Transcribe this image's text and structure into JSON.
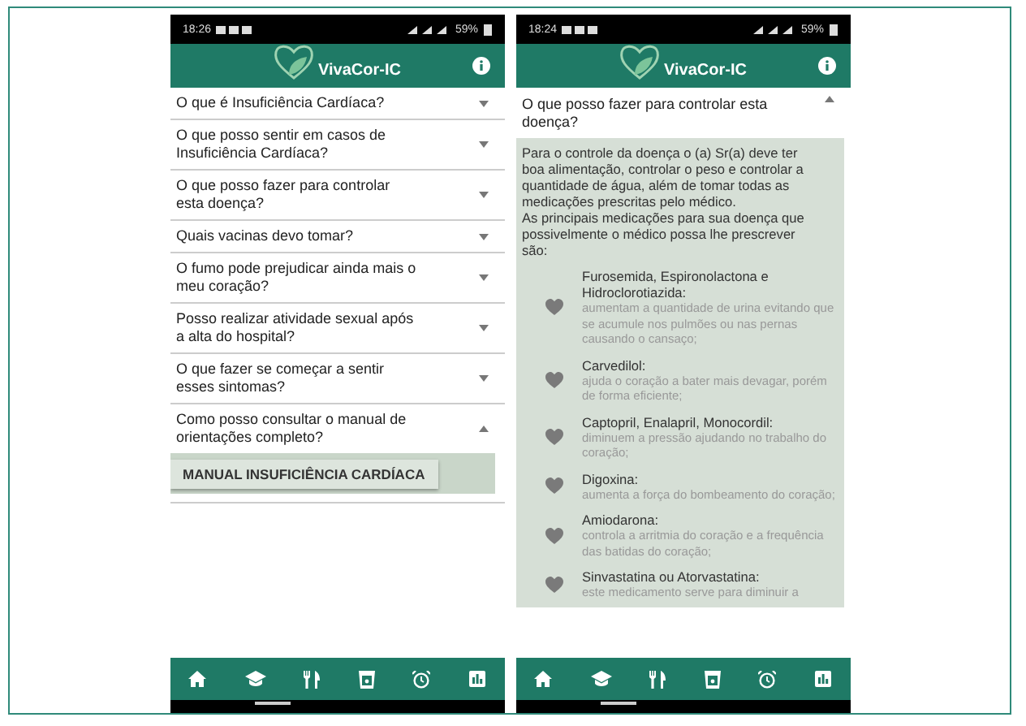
{
  "left_screen": {
    "status_bar": {
      "time": "18:26",
      "battery": "59%"
    },
    "app_title": "VivaCor-IC",
    "faq": [
      {
        "question": "O que é Insuficiência Cardíaca?",
        "expanded": false
      },
      {
        "question": "O que posso sentir em casos de Insuficiência Cardíaca?",
        "expanded": false
      },
      {
        "question": "O que posso fazer para controlar esta doença?",
        "expanded": false
      },
      {
        "question": "Quais vacinas devo tomar?",
        "expanded": false
      },
      {
        "question": "O fumo pode prejudicar ainda mais o meu coração?",
        "expanded": false
      },
      {
        "question": "Posso realizar atividade sexual após a alta do hospital?",
        "expanded": false
      },
      {
        "question": "O que fazer se começar a sentir esses sintomas?",
        "expanded": false
      },
      {
        "question": "Como posso consultar o manual de orientações completo?",
        "expanded": true,
        "button": "MANUAL INSUFICIÊNCIA CARDÍACA"
      }
    ],
    "nav": [
      {
        "kind": "home"
      },
      {
        "kind": "learn"
      },
      {
        "kind": "food"
      },
      {
        "kind": "cup"
      },
      {
        "kind": "alarm"
      },
      {
        "kind": "chart"
      }
    ]
  },
  "right_screen": {
    "status_bar": {
      "time": "18:24",
      "battery": "59%"
    },
    "app_title": "VivaCor-IC",
    "question": "O que posso fazer para controlar esta doença?",
    "expanded": true,
    "answer_lines": [
      "Para o controle da doença o (a) Sr(a) deve ter",
      "boa alimentação, controlar o peso e controlar a",
      "quantidade de água, além de tomar todas as",
      "medicações prescritas pelo médico.",
      "As principais medicações para sua doença que",
      "possivelmente o médico possa lhe prescrever",
      "são:"
    ],
    "medications": [
      {
        "name": "Furosemida, Espironolactona e Hidroclorotiazida:",
        "description": "aumentam a quantidade de urina evitando que se acumule nos pulmões ou nas pernas causando o cansaço;"
      },
      {
        "name": "Carvedilol:",
        "description": "ajuda o coração a bater mais devagar, porém de forma eficiente;"
      },
      {
        "name": "Captopril, Enalapril, Monocordil:",
        "description": "diminuem a pressão ajudando no trabalho do coração;"
      },
      {
        "name": "Digoxina:",
        "description": "aumenta a força do bombeamento do coração;"
      },
      {
        "name": "Amiodarona:",
        "description": "controla a arritmia do coração e a frequência das batidas do coração;"
      },
      {
        "name": "Sinvastatina ou Atorvastatina:",
        "description": "este medicamento serve para diminuir a"
      }
    ],
    "nav": [
      {
        "kind": "home"
      },
      {
        "kind": "learn"
      },
      {
        "kind": "food"
      },
      {
        "kind": "cup"
      },
      {
        "kind": "alarm"
      },
      {
        "kind": "chart"
      }
    ]
  }
}
